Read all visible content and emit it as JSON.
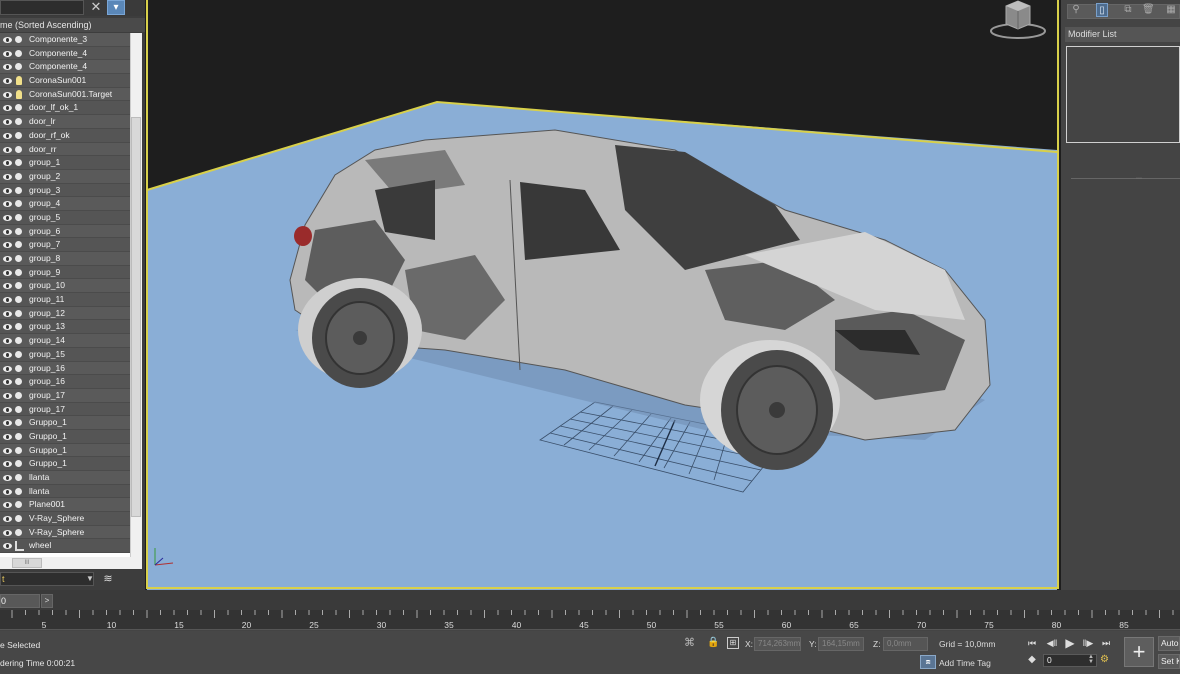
{
  "explorer": {
    "header": "me (Sorted Ascending)",
    "items": [
      {
        "label": "Componente_3",
        "icon": "object-sphere-icon"
      },
      {
        "label": "Componente_4",
        "icon": "object-sphere-icon"
      },
      {
        "label": "Componente_4",
        "icon": "object-sphere-icon"
      },
      {
        "label": "CoronaSun001",
        "icon": "light-bulb-icon"
      },
      {
        "label": "CoronaSun001.Target",
        "icon": "light-bulb-icon"
      },
      {
        "label": "door_lf_ok_1",
        "icon": "object-sphere-icon"
      },
      {
        "label": "door_lr",
        "icon": "object-sphere-icon"
      },
      {
        "label": "door_rf_ok",
        "icon": "object-sphere-icon"
      },
      {
        "label": "door_rr",
        "icon": "object-sphere-icon"
      },
      {
        "label": "group_1",
        "icon": "object-sphere-icon"
      },
      {
        "label": "group_2",
        "icon": "object-sphere-icon"
      },
      {
        "label": "group_3",
        "icon": "object-sphere-icon"
      },
      {
        "label": "group_4",
        "icon": "object-sphere-icon"
      },
      {
        "label": "group_5",
        "icon": "object-sphere-icon"
      },
      {
        "label": "group_6",
        "icon": "object-sphere-icon"
      },
      {
        "label": "group_7",
        "icon": "object-sphere-icon"
      },
      {
        "label": "group_8",
        "icon": "object-sphere-icon"
      },
      {
        "label": "group_9",
        "icon": "object-sphere-icon"
      },
      {
        "label": "group_10",
        "icon": "object-sphere-icon"
      },
      {
        "label": "group_11",
        "icon": "object-sphere-icon"
      },
      {
        "label": "group_12",
        "icon": "object-sphere-icon"
      },
      {
        "label": "group_13",
        "icon": "object-sphere-icon"
      },
      {
        "label": "group_14",
        "icon": "object-sphere-icon"
      },
      {
        "label": "group_15",
        "icon": "object-sphere-icon"
      },
      {
        "label": "group_16",
        "icon": "object-sphere-icon"
      },
      {
        "label": "group_16",
        "icon": "object-sphere-icon"
      },
      {
        "label": "group_17",
        "icon": "object-sphere-icon"
      },
      {
        "label": "group_17",
        "icon": "object-sphere-icon"
      },
      {
        "label": "Gruppo_1",
        "icon": "object-sphere-icon"
      },
      {
        "label": "Gruppo_1",
        "icon": "object-sphere-icon"
      },
      {
        "label": "Gruppo_1",
        "icon": "object-sphere-icon"
      },
      {
        "label": "Gruppo_1",
        "icon": "object-sphere-icon"
      },
      {
        "label": "llanta",
        "icon": "object-sphere-icon"
      },
      {
        "label": "llanta",
        "icon": "object-sphere-icon"
      },
      {
        "label": "Plane001",
        "icon": "object-sphere-icon"
      },
      {
        "label": "V-Ray_Sphere",
        "icon": "object-sphere-icon"
      },
      {
        "label": "V-Ray_Sphere",
        "icon": "object-sphere-icon"
      },
      {
        "label": "wheel",
        "icon": "bone-icon"
      }
    ],
    "hscroll_grip": "III",
    "layer_value": "t"
  },
  "command_panel": {
    "modifier_list": "Modifier List"
  },
  "timeslider": {
    "frame_value": "0",
    "next_label": ">"
  },
  "trackbar": {
    "labels": [
      "5",
      "10",
      "15",
      "20",
      "25",
      "30",
      "35",
      "40",
      "45",
      "50",
      "55",
      "60",
      "65",
      "70",
      "75",
      "80",
      "85"
    ]
  },
  "status": {
    "selected_text": "e Selected",
    "render_text": "dering Time  0:00:21",
    "x_label": "X:",
    "x_value": "714,263mm",
    "y_label": "Y:",
    "y_value": "164,15mm",
    "z_label": "Z:",
    "z_value": "0,0mm",
    "grid_text": "Grid = 10,0mm",
    "time_tag": "Add Time Tag",
    "current_frame": "0",
    "auto_key": "Auto",
    "set_key": "Set K"
  },
  "colors": {
    "viewport_bg": "#1e1e1e",
    "ground": "#8aaed6",
    "active_border": "#d8d04a",
    "selection_accent": "#5a87b8"
  }
}
